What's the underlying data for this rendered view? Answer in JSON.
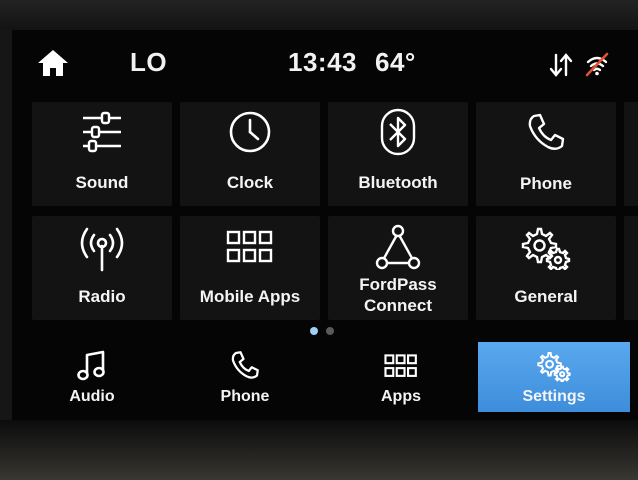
{
  "status": {
    "mode": "LO",
    "time": "13:43",
    "temperature": "64°"
  },
  "tiles": [
    {
      "label": "Sound",
      "icon": "equalizer-sliders-icon"
    },
    {
      "label": "Clock",
      "icon": "clock-icon"
    },
    {
      "label": "Bluetooth",
      "icon": "bluetooth-icon"
    },
    {
      "label": "Phone",
      "icon": "phone-icon"
    },
    {
      "label": "Radio",
      "icon": "radio-antenna-icon"
    },
    {
      "label": "Mobile Apps",
      "icon": "app-grid-icon"
    },
    {
      "label": "FordPass\nConnect",
      "label_line1": "FordPass",
      "label_line2": "Connect",
      "icon": "network-triangle-icon"
    },
    {
      "label": "General",
      "icon": "gears-icon"
    }
  ],
  "pagination": {
    "pages": 2,
    "current": 1
  },
  "bottom_nav": [
    {
      "label": "Audio",
      "icon": "music-note-icon"
    },
    {
      "label": "Phone",
      "icon": "phone-icon"
    },
    {
      "label": "Apps",
      "icon": "app-grid-icon"
    },
    {
      "label": "Settings",
      "icon": "gears-icon",
      "selected": true
    }
  ],
  "colors": {
    "accent": "#4a9be6",
    "tile": "#131313",
    "screen": "#050505",
    "dot_active": "#9ed0f5"
  }
}
